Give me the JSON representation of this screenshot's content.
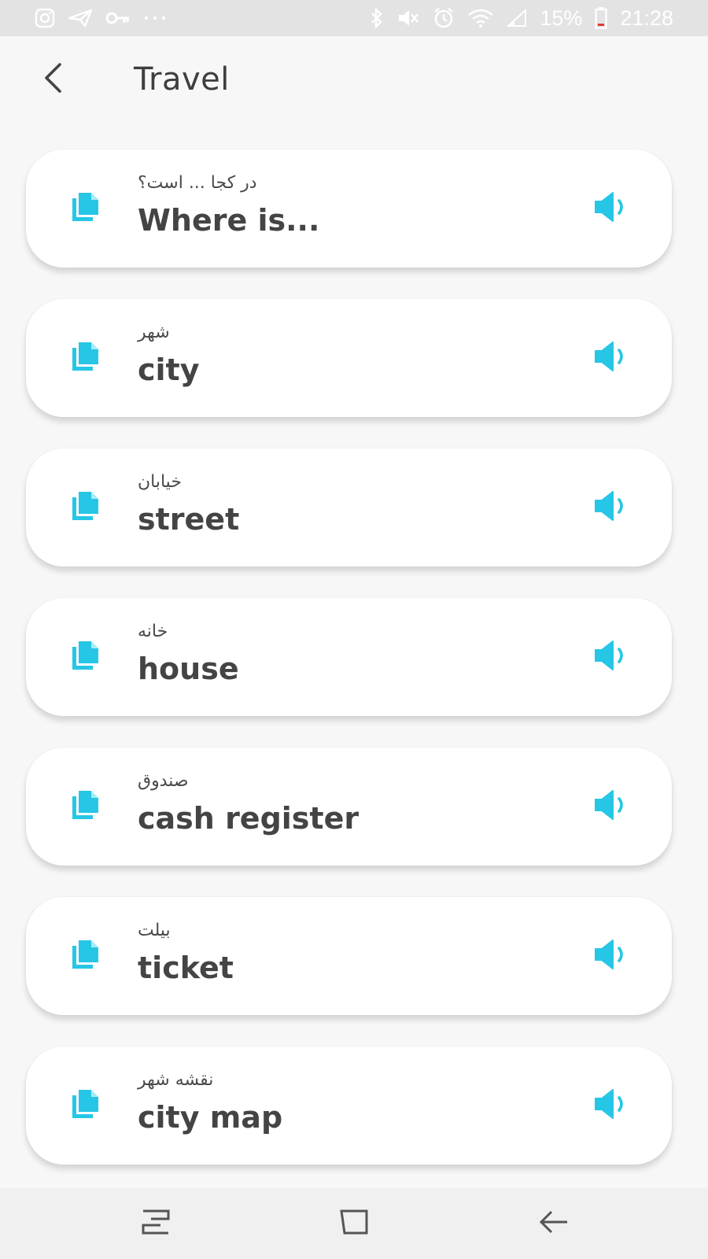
{
  "status_bar": {
    "left_icons": [
      "instagram-icon",
      "send-icon",
      "key-icon",
      "more-dots-icon"
    ],
    "right_icons": [
      "bluetooth-icon",
      "mute-icon",
      "alarm-icon",
      "wifi-icon",
      "signal-icon",
      "battery-icon"
    ],
    "battery": "15%",
    "time": "21:28"
  },
  "header": {
    "back_icon": "chevron-left-icon",
    "title": "Travel"
  },
  "phrases": [
    {
      "translation": "در کجا ... است؟",
      "english": "Where is..."
    },
    {
      "translation": "شهر",
      "english": "city"
    },
    {
      "translation": "خیابان",
      "english": "street"
    },
    {
      "translation": "خانه",
      "english": "house"
    },
    {
      "translation": "صندوق",
      "english": "cash register"
    },
    {
      "translation": "بیلت",
      "english": "ticket"
    },
    {
      "translation": "نقشه شهر",
      "english": "city map"
    }
  ],
  "icons": {
    "copy": "copy-icon",
    "speaker": "speaker-icon"
  },
  "colors": {
    "accent": "#26c6e6",
    "text_primary": "#444444",
    "text_secondary": "#4a4a4a",
    "background": "#f7f7f7",
    "card": "#ffffff",
    "status_bar": "#e3e3e3"
  },
  "nav_bar": {
    "items": [
      "recents-icon",
      "home-icon",
      "back-icon"
    ]
  }
}
